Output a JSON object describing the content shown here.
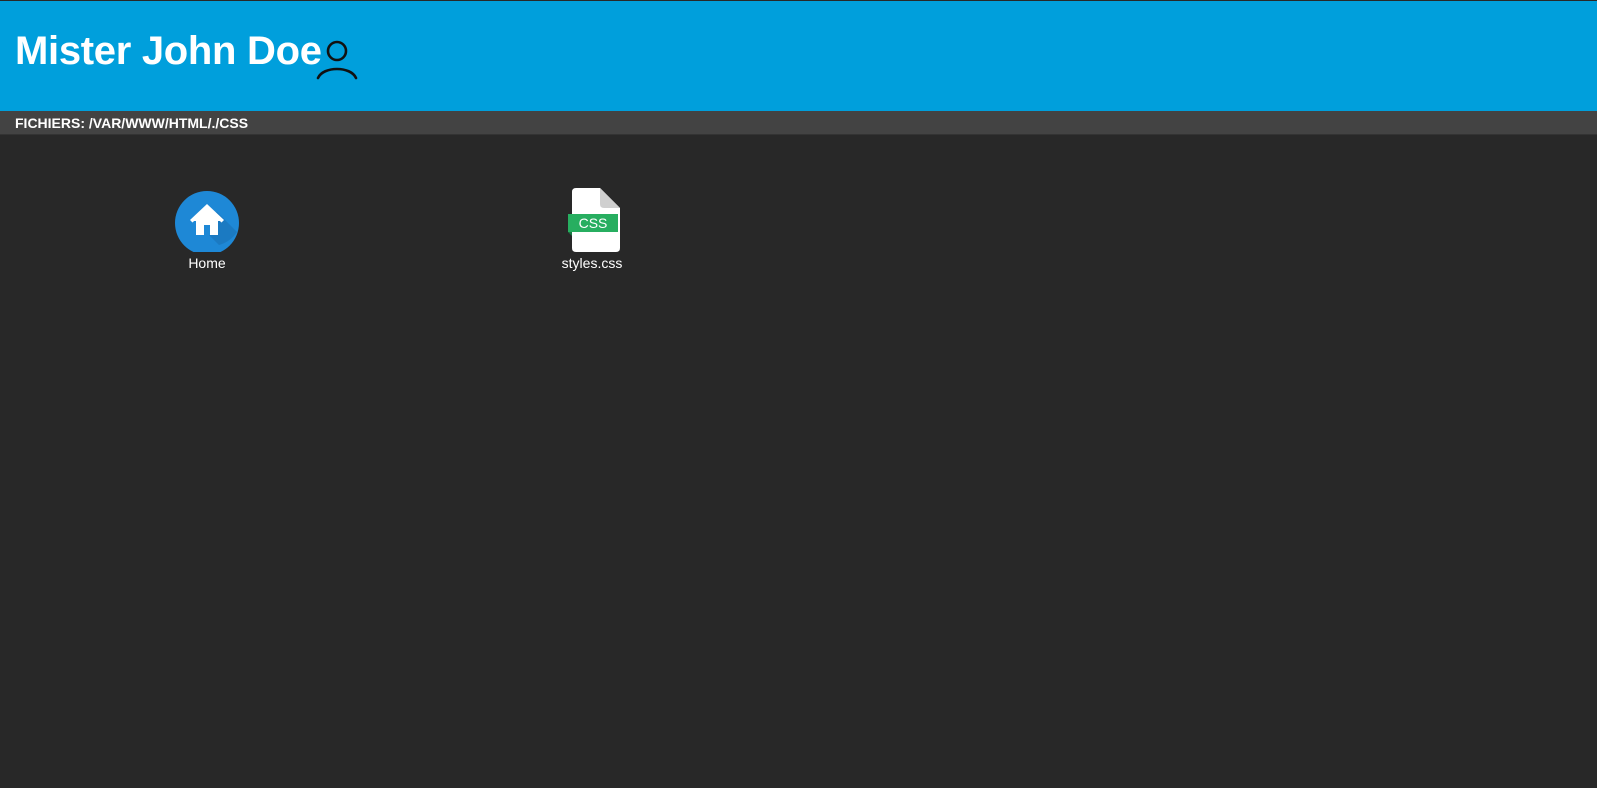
{
  "header": {
    "user_name": "Mister John Doe",
    "user_icon": "user-icon",
    "background_color": "#009fdc"
  },
  "pathbar": {
    "label": "FICHIERS: /VAR/WWW/HTML/./CSS"
  },
  "files": [
    {
      "name": "Home",
      "icon": "home-icon",
      "type": "folder"
    },
    {
      "name": "styles.css",
      "icon": "css-file-icon",
      "type": "file",
      "badge": "CSS",
      "badge_color": "#27ae60"
    }
  ],
  "colors": {
    "background": "#282828",
    "pathbar": "#434343",
    "home_circle": "#1e88d6"
  }
}
